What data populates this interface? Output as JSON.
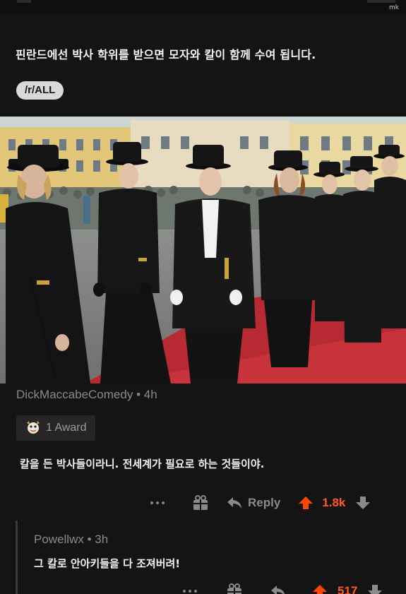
{
  "watermark": "mk",
  "post": {
    "title": "핀란드에선 박사 학위를 받으면 모자와 칼이 함께 수여 됩니다.",
    "subreddit": "/r/ALL"
  },
  "comments": [
    {
      "author": "DickMaccabeComedy",
      "time": "4h",
      "award": "1 Award",
      "body": "칼을 든 박사들이라니. 전세계가 필요로 하는 것들이야.",
      "reply_label": "Reply",
      "votes": "1.8k"
    },
    {
      "author": "Powellwx",
      "time": "3h",
      "body": "그 칼로 안아키들을 다 조져버려!",
      "votes": "517"
    }
  ],
  "colors": {
    "background": "#141414",
    "upvote": "#ff5a1f",
    "muted": "#8a8a8a",
    "carpet": "#c8323a"
  },
  "icons": [
    "more-icon",
    "gift-icon",
    "reply-arrow-icon",
    "upvote-icon",
    "downvote-icon",
    "award-icon"
  ]
}
